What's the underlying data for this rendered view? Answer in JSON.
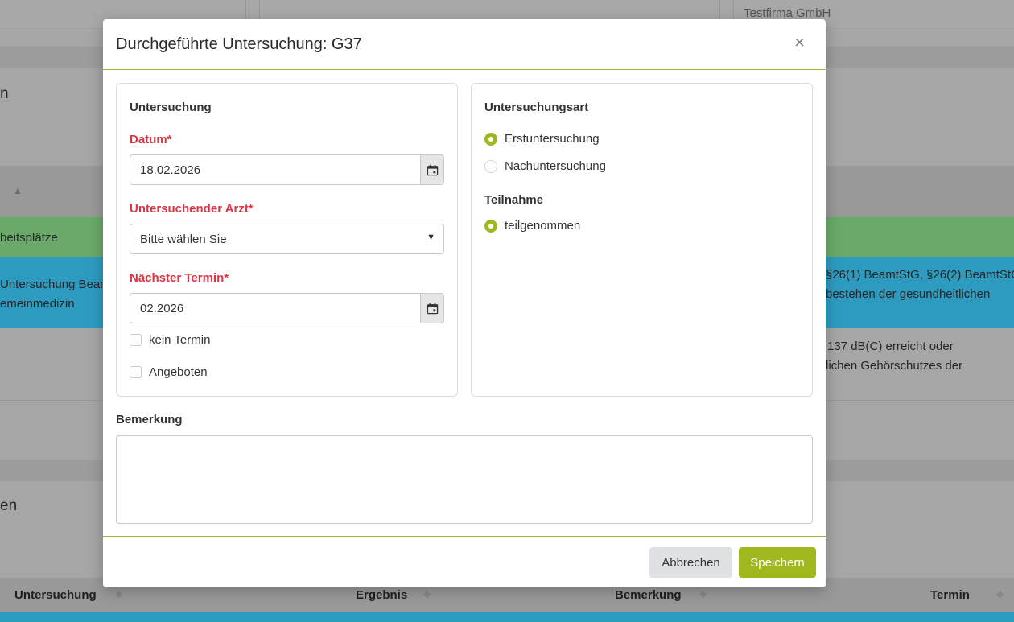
{
  "background": {
    "company_name": "Testfirma GmbH",
    "section_heading_1_fragment": "n",
    "section_heading_2_fragment": "en",
    "sort_arrow_up": "▲",
    "green_row_text": "beitsplätze",
    "blue_row_left_line1": "Untersuchung Beam",
    "blue_row_left_line2": "emeinmedizin",
    "blue_row_right_line1": "§26(1) BeamtStG, §26(2) BeamtStG",
    "blue_row_right_line2": "bestehen der gesundheitlichen",
    "white_row_right_line1": "137 dB(C) erreicht oder",
    "white_row_right_line2": "lichen Gehörschutzes der",
    "table_headers": [
      "Untersuchung",
      "Ergebnis",
      "Bemerkung",
      "Termin"
    ]
  },
  "modal": {
    "title": "Durchgeführte Untersuchung: G37",
    "close_symbol": "×",
    "untersuchung_card": {
      "title": "Untersuchung",
      "datum_label": "Datum*",
      "datum_value": "18.02.2026",
      "arzt_label": "Untersuchender Arzt*",
      "arzt_value": "Bitte wählen Sie",
      "naechster_termin_label": "Nächster Termin*",
      "naechster_termin_value": "02.2026",
      "kein_termin_label": "kein Termin",
      "kein_termin_checked": false,
      "angeboten_label": "Angeboten",
      "angeboten_checked": false
    },
    "untersuchungsart_card": {
      "title": "Untersuchungsart",
      "options": [
        {
          "label": "Erstuntersuchung",
          "selected": true
        },
        {
          "label": "Nachuntersuchung",
          "selected": false
        }
      ],
      "teilnahme_title": "Teilnahme",
      "teilnahme_options": [
        {
          "label": "teilgenommen",
          "selected": true
        }
      ]
    },
    "bemerkung_label": "Bemerkung",
    "bemerkung_value": "",
    "footer": {
      "cancel_label": "Abbrechen",
      "save_label": "Speichern"
    }
  },
  "colors": {
    "accent": "#a1b71e",
    "required": "#dc3545",
    "green_row_bg": "#6aa96a",
    "blue_row_bg": "#2d9bc0"
  },
  "icons": {
    "calendar": "calendar-icon",
    "close": "close-icon",
    "dropdown": "caret-down-icon",
    "sort": "sort-icon"
  }
}
